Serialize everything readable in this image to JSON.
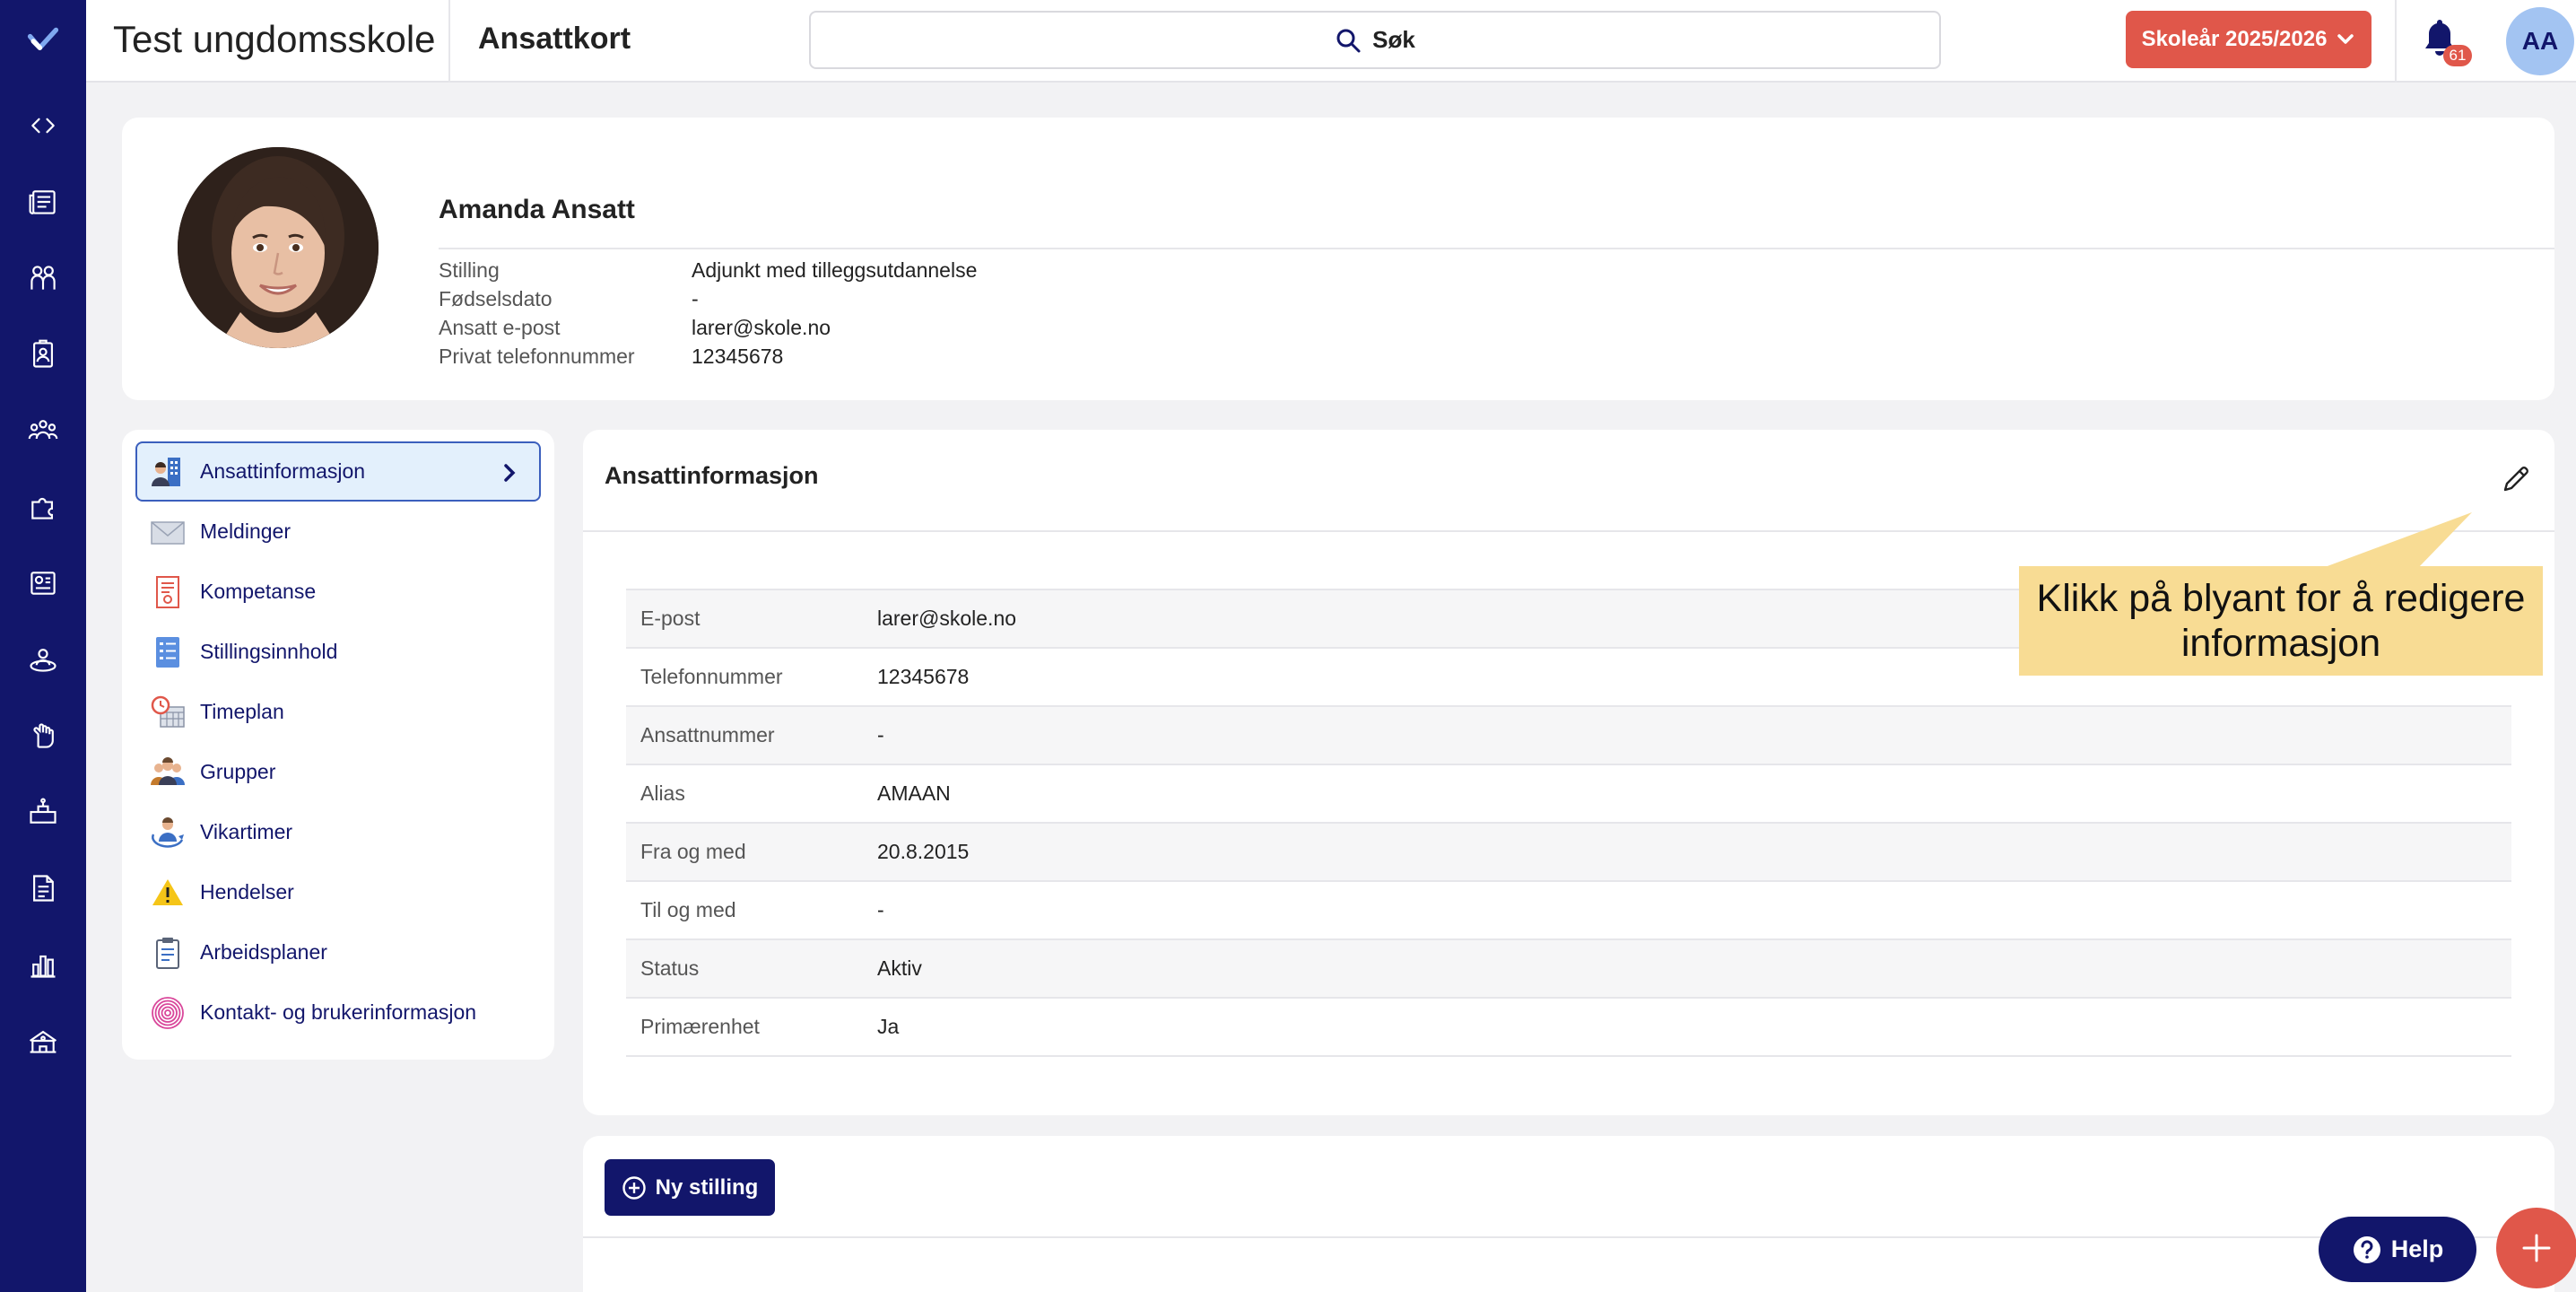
{
  "header": {
    "app_title": "Test ungdomsskole",
    "page_title": "Ansattkort",
    "search_label": "Søk",
    "school_year_label": "Skoleår 2025/2026",
    "notification_count": "61",
    "user_initials": "AA"
  },
  "sidebar": {
    "items": [
      {
        "icon": "expand-collapse-icon"
      },
      {
        "icon": "newspaper-icon"
      },
      {
        "icon": "people-icon"
      },
      {
        "icon": "id-badge-icon"
      },
      {
        "icon": "group-icon"
      },
      {
        "icon": "puzzle-icon"
      },
      {
        "icon": "dashboard-icon"
      },
      {
        "icon": "person-orbit-icon"
      },
      {
        "icon": "hand-icon"
      },
      {
        "icon": "desk-icon"
      },
      {
        "icon": "document-icon"
      },
      {
        "icon": "bar-chart-icon"
      },
      {
        "icon": "school-icon"
      }
    ]
  },
  "profile": {
    "name": "Amanda Ansatt",
    "fields": [
      {
        "label": "Stilling",
        "value": "Adjunkt med tilleggsutdannelse"
      },
      {
        "label": "Fødselsdato",
        "value": "-"
      },
      {
        "label": "Ansatt e-post",
        "value": "larer@skole.no"
      },
      {
        "label": "Privat telefonnummer",
        "value": "12345678"
      }
    ]
  },
  "menu": {
    "items": [
      {
        "label": "Ansattinformasjon",
        "icon": "employee-info-icon",
        "active": true
      },
      {
        "label": "Meldinger",
        "icon": "envelope-icon"
      },
      {
        "label": "Kompetanse",
        "icon": "certificate-icon"
      },
      {
        "label": "Stillingsinnhold",
        "icon": "list-doc-icon"
      },
      {
        "label": "Timeplan",
        "icon": "schedule-icon"
      },
      {
        "label": "Grupper",
        "icon": "groups-icon"
      },
      {
        "label": "Vikartimer",
        "icon": "substitute-icon"
      },
      {
        "label": "Hendelser",
        "icon": "warning-icon"
      },
      {
        "label": "Arbeidsplaner",
        "icon": "clipboard-icon"
      },
      {
        "label": "Kontakt- og brukerinformasjon",
        "icon": "fingerprint-icon"
      }
    ]
  },
  "info": {
    "title": "Ansattinformasjon",
    "rows": [
      {
        "label": "E-post",
        "value": "larer@skole.no"
      },
      {
        "label": "Telefonnummer",
        "value": "12345678"
      },
      {
        "label": "Ansattnummer",
        "value": "-"
      },
      {
        "label": "Alias",
        "value": "AMAAN"
      },
      {
        "label": "Fra og med",
        "value": "20.8.2015"
      },
      {
        "label": "Til og med",
        "value": "-"
      },
      {
        "label": "Status",
        "value": "Aktiv"
      },
      {
        "label": "Primærenhet",
        "value": "Ja"
      }
    ]
  },
  "callout": {
    "text": "Klikk på blyant for å redigere informasjon"
  },
  "actions": {
    "new_position_label": "Ny stilling",
    "help_label": "Help"
  },
  "colors": {
    "navy": "#12166b",
    "coral": "#e0574a",
    "callout": "#f8dc94",
    "active_bg": "#e3f0fc"
  }
}
